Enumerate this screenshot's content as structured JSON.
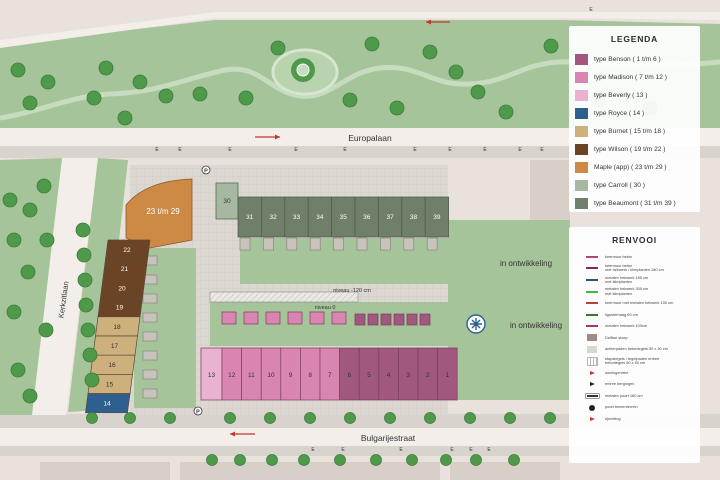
{
  "streets": {
    "europalaan": "Europalaan",
    "bulgarijestraat": "Bulgarijestraat",
    "kerkzitstraat": "Kerkzitlaan"
  },
  "plan_labels": {
    "development_1": "in ontwikkeling",
    "development_2": "in ontwikkeling",
    "level_minus": "niveau -120 cm",
    "level_zero": "niveau 0",
    "parking_symbol": "P",
    "edge_letter": "E"
  },
  "lots": {
    "maple": "23 t/m 29",
    "north_row": [
      "30",
      "31",
      "32",
      "33",
      "34",
      "35",
      "36",
      "37",
      "38",
      "39"
    ],
    "west_row": [
      "22",
      "21",
      "20",
      "19",
      "18",
      "17",
      "16",
      "15",
      "14"
    ],
    "south_row": [
      "13",
      "12",
      "11",
      "10",
      "9",
      "8",
      "7",
      "6",
      "5",
      "4",
      "3",
      "2",
      "1"
    ]
  },
  "legend": {
    "title": "LEGENDA",
    "items": [
      {
        "label": "type Benson ( 1 t/m 6 )",
        "color": "#a0587e"
      },
      {
        "label": "type Madison ( 7 t/m 12 )",
        "color": "#d985b2"
      },
      {
        "label": "type Beverly ( 13 )",
        "color": "#e9b3d0"
      },
      {
        "label": "type Royce ( 14 )",
        "color": "#2f5f8c"
      },
      {
        "label": "type Burnet ( 15 t/m 18 )",
        "color": "#cdb07c"
      },
      {
        "label": "type Wilson ( 19 t/m 22 )",
        "color": "#6b4426"
      },
      {
        "label": "Maple (app) ( 23 t/m 29 )",
        "color": "#cc8a45"
      },
      {
        "label": "type Carroll ( 30 )",
        "color": "#a6b8a0"
      },
      {
        "label": "type Beaumont ( 31 t/m 39 )",
        "color": "#6f7f69"
      }
    ]
  },
  "renvooi": {
    "title": "RENVOOI",
    "items": [
      {
        "label": "keermuur beton",
        "sym": "line",
        "color": "#b0487a"
      },
      {
        "label": "keermuur beton\nmet hekwerk / klimplanten 180 cm",
        "sym": "line",
        "color": "#7a2e55"
      },
      {
        "label": "metalen hekwerk 180 cm\nmet klimplanten",
        "sym": "line",
        "color": "#3c4d7a"
      },
      {
        "label": "metalen hekwerk 300 cm\nmet klimplanten",
        "sym": "line",
        "color": "#4fae4a"
      },
      {
        "label": "keermuur met metalen hekwerk 100 cm",
        "sym": "line",
        "color": "#c03b3b"
      },
      {
        "label": "ligusterhaag 60 cm",
        "sym": "line",
        "color": "#2f7d2b"
      },
      {
        "label": "metalen hekwerk 100cm",
        "sym": "line",
        "color": "#9b3b6a"
      },
      {
        "label": "Delftse stoep",
        "sym": "box",
        "color": "#9c8c86"
      },
      {
        "label": "achterpaden betontegels 30 x 30 cm",
        "sym": "box",
        "color": "#d9d6d2"
      },
      {
        "label": "stapstegels / tegelpaden entree\nbetontegels 50 x 50 cm",
        "sym": "grid",
        "color": "#bbb6b0"
      },
      {
        "label": "woningentree",
        "sym": "arrow",
        "color": "#c0392b"
      },
      {
        "label": "entree bergingen",
        "sym": "arrow",
        "color": "#222222"
      },
      {
        "label": "metalen poort 180 cm",
        "sym": "gate",
        "color": "#333333"
      },
      {
        "label": "poort binnenterrein",
        "sym": "circle",
        "color": "#222222"
      },
      {
        "label": "rijrichting",
        "sym": "arrow",
        "color": "#c0392b"
      }
    ]
  },
  "colors": {
    "background": "#e9e2dc",
    "grass": "#a6c49a",
    "road": "#f3eeea",
    "footpath": "#d9d3cd",
    "tree": "#4f9a4a",
    "shrub": "#6aaa5c"
  }
}
